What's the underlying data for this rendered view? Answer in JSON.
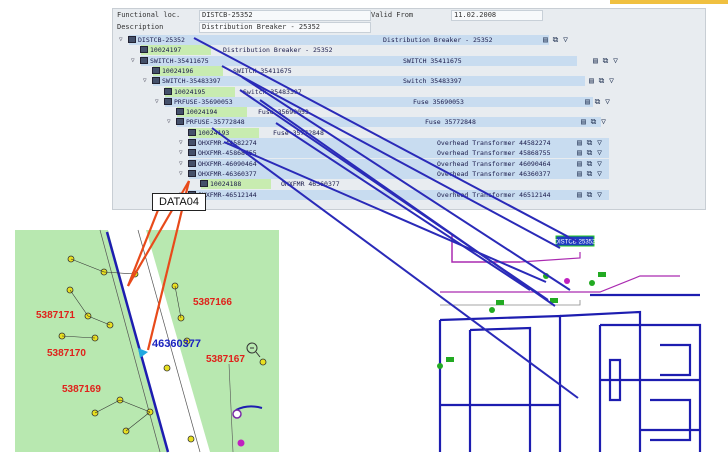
{
  "header": {
    "functional_loc_label": "Functional loc.",
    "functional_loc_value": "DISTCB-25352",
    "description_label": "Description",
    "description_value": "Distribution Breaker - 25352",
    "valid_from_label": "Valid From",
    "valid_from_value": "11.02.2008"
  },
  "tree": [
    {
      "id": "DISTCB-25352",
      "desc": "Distribution Breaker - 25352",
      "level": 0,
      "type": "node"
    },
    {
      "id": "10024197",
      "desc": "Distribution Breaker - 25352",
      "level": 1,
      "type": "leaf"
    },
    {
      "id": "SWITCH-35411675",
      "desc": "SWITCH 35411675",
      "level": 1,
      "type": "node"
    },
    {
      "id": "10024196",
      "desc": "SWITCH 35411675",
      "level": 2,
      "type": "leaf"
    },
    {
      "id": "SWITCH-35483397",
      "desc": "Switch 35483397",
      "level": 2,
      "type": "node"
    },
    {
      "id": "10024195",
      "desc": "Switch 35483397",
      "level": 3,
      "type": "leaf"
    },
    {
      "id": "PRFUSE-35690053",
      "desc": "Fuse 35690053",
      "level": 3,
      "type": "node"
    },
    {
      "id": "10024194",
      "desc": "Fuse 35690053",
      "level": 4,
      "type": "leaf"
    },
    {
      "id": "PRFUSE-35772848",
      "desc": "Fuse 35772848",
      "level": 4,
      "type": "node"
    },
    {
      "id": "10024193",
      "desc": "Fuse 35772848",
      "level": 5,
      "type": "leaf"
    },
    {
      "id": "OHXFMR-44582274",
      "desc": "Overhead Transformer 44582274",
      "level": 5,
      "type": "node"
    },
    {
      "id": "OHXFMR-45868755",
      "desc": "Overhead Transformer 45868755",
      "level": 5,
      "type": "node"
    },
    {
      "id": "OHXFMR-46090464",
      "desc": "Overhead Transformer 46090464",
      "level": 5,
      "type": "node"
    },
    {
      "id": "OHXFMR-46360377",
      "desc": "Overhead Transformer 46360377",
      "level": 5,
      "type": "node"
    },
    {
      "id": "10024188",
      "desc": "OHXFMR 46360377",
      "level": 6,
      "type": "leaf"
    },
    {
      "id": "OHXFMR-46512144",
      "desc": "Overhead Transformer 46512144",
      "level": 5,
      "type": "node"
    }
  ],
  "callout": "DATA04",
  "map_left": {
    "labels": [
      "5387171",
      "5387166",
      "5387170",
      "5387167",
      "5387169"
    ],
    "transformer_id": "46360377"
  },
  "map_right": {
    "tag": "DISTCB-25352"
  },
  "colors": {
    "connector": "#2a2ab8",
    "callout_line": "#e84a1a",
    "highlight": "#c8ecb0",
    "sel_band": "#c8dcf0"
  }
}
